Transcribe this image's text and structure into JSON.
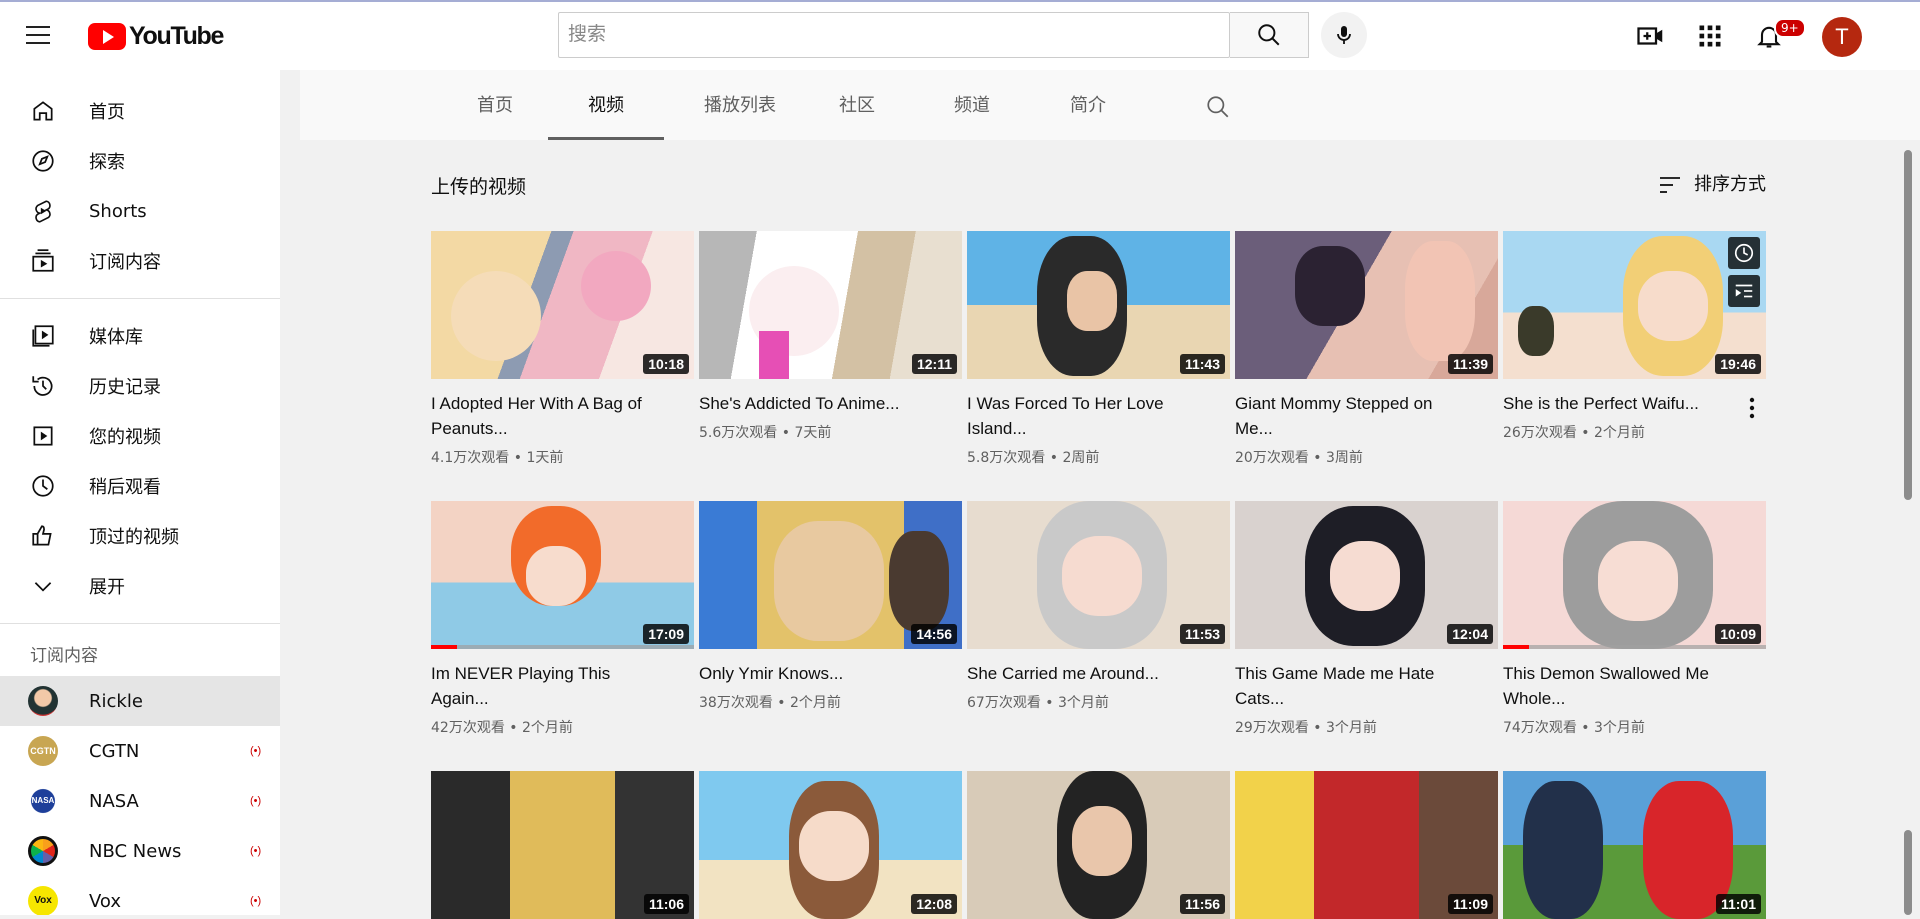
{
  "topbar": {
    "logo_text": "YouTube",
    "search_placeholder": "搜索",
    "notifications_badge": "9+",
    "avatar_letter": "T",
    "brand_color": "#ff0000"
  },
  "sidebar": {
    "main": [
      {
        "label": "首页",
        "icon": "home-icon"
      },
      {
        "label": "探索",
        "icon": "compass-icon"
      },
      {
        "label": "Shorts",
        "icon": "shorts-icon"
      },
      {
        "label": "订阅内容",
        "icon": "subscriptions-icon"
      }
    ],
    "library": [
      {
        "label": "媒体库",
        "icon": "library-icon"
      },
      {
        "label": "历史记录",
        "icon": "history-icon"
      },
      {
        "label": "您的视频",
        "icon": "your-videos-icon"
      },
      {
        "label": "稍后观看",
        "icon": "watch-later-icon"
      },
      {
        "label": "顶过的视频",
        "icon": "liked-icon"
      },
      {
        "label": "展开",
        "icon": "chevron-down-icon"
      }
    ],
    "subscriptions_header": "订阅内容",
    "subscriptions": [
      {
        "name": "Rickle",
        "active": true
      },
      {
        "name": "CGTN",
        "live": "(•)"
      },
      {
        "name": "NASA",
        "live": "(•)"
      },
      {
        "name": "NBC News",
        "live": "(•)"
      },
      {
        "name": "Vox",
        "live": "(•)"
      }
    ]
  },
  "channel_tabs": [
    "首页",
    "视频",
    "播放列表",
    "社区",
    "频道",
    "简介"
  ],
  "active_tab": "视频",
  "section": {
    "title": "上传的视频",
    "sort_label": "排序方式"
  },
  "videos": [
    {
      "title": "I Adopted Her With A Bag of Peanuts...",
      "views": "4.1万次观看",
      "age": "1天前",
      "duration": "10:18"
    },
    {
      "title": "She's Addicted To Anime...",
      "views": "5.6万次观看",
      "age": "7天前",
      "duration": "12:11"
    },
    {
      "title": "I Was Forced To Her Love Island...",
      "views": "5.8万次观看",
      "age": "2周前",
      "duration": "11:43"
    },
    {
      "title": "Giant Mommy Stepped on Me...",
      "views": "20万次观看",
      "age": "3周前",
      "duration": "11:39"
    },
    {
      "title": "She is the Perfect Waifu...",
      "views": "26万次观看",
      "age": "2个月前",
      "duration": "19:46"
    },
    {
      "title": "Im NEVER Playing This Again...",
      "views": "42万次观看",
      "age": "2个月前",
      "duration": "17:09",
      "progress": 0.1
    },
    {
      "title": "Only Ymir Knows...",
      "views": "38万次观看",
      "age": "2个月前",
      "duration": "14:56"
    },
    {
      "title": "She Carried me Around...",
      "views": "67万次观看",
      "age": "3个月前",
      "duration": "11:53"
    },
    {
      "title": "This Game Made me Hate Cats...",
      "views": "29万次观看",
      "age": "3个月前",
      "duration": "12:04"
    },
    {
      "title": "This Demon Swallowed Me Whole...",
      "views": "74万次观看",
      "age": "3个月前",
      "duration": "10:09",
      "progress": 0.1
    },
    {
      "duration": "11:06"
    },
    {
      "duration": "12:08"
    },
    {
      "duration": "11:56"
    },
    {
      "duration": "11:09"
    },
    {
      "duration": "11:01"
    }
  ]
}
